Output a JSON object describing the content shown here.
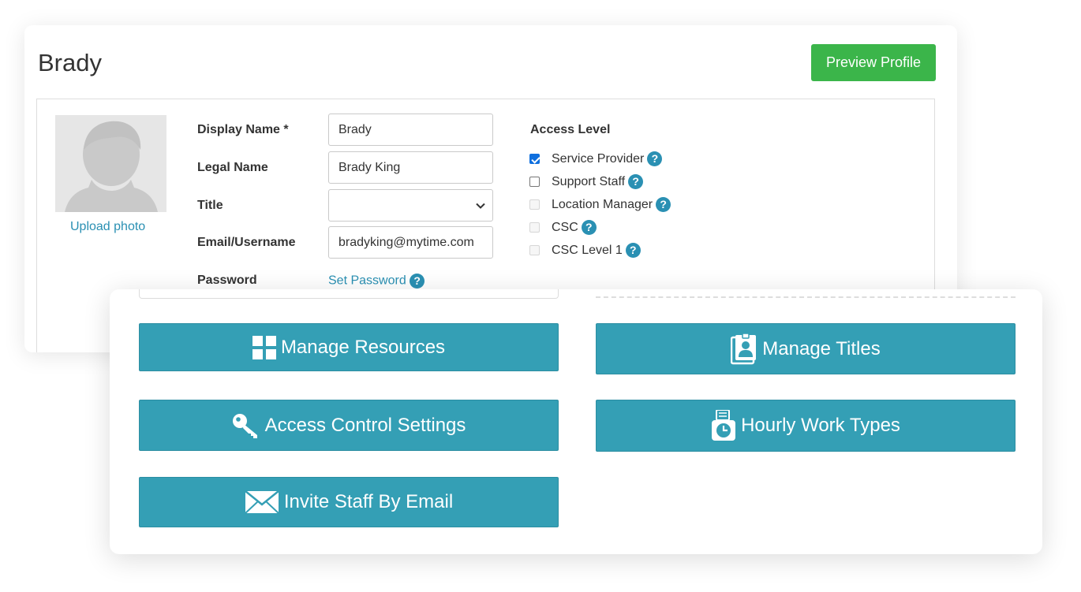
{
  "profile": {
    "name": "Brady",
    "preview_label": "Preview Profile",
    "upload_label": "Upload photo"
  },
  "form": {
    "display_name_label": "Display Name *",
    "display_name_value": "Brady",
    "legal_name_label": "Legal Name",
    "legal_name_value": "Brady King",
    "title_label": "Title",
    "title_value": "",
    "email_label": "Email/Username",
    "email_value": "bradyking@mytime.com",
    "password_label": "Password",
    "set_password_label": "Set Password"
  },
  "access": {
    "title": "Access Level",
    "options": [
      {
        "label": "Service Provider",
        "checked": true,
        "disabled": false
      },
      {
        "label": "Support Staff",
        "checked": false,
        "disabled": false
      },
      {
        "label": "Location Manager",
        "checked": false,
        "disabled": true
      },
      {
        "label": "CSC",
        "checked": false,
        "disabled": true
      },
      {
        "label": "CSC Level 1",
        "checked": false,
        "disabled": true
      }
    ]
  },
  "help_glyph": "?",
  "actions": {
    "manage_resources": "Manage Resources",
    "manage_titles": "Manage Titles",
    "access_control": "Access Control Settings",
    "hourly_work_types": "Hourly Work Types",
    "invite_staff": "Invite Staff By Email"
  },
  "colors": {
    "accent": "#349fb5",
    "link": "#2a90b3",
    "preview_button": "#3bb54a",
    "checkbox_checked": "#0f6fde"
  }
}
